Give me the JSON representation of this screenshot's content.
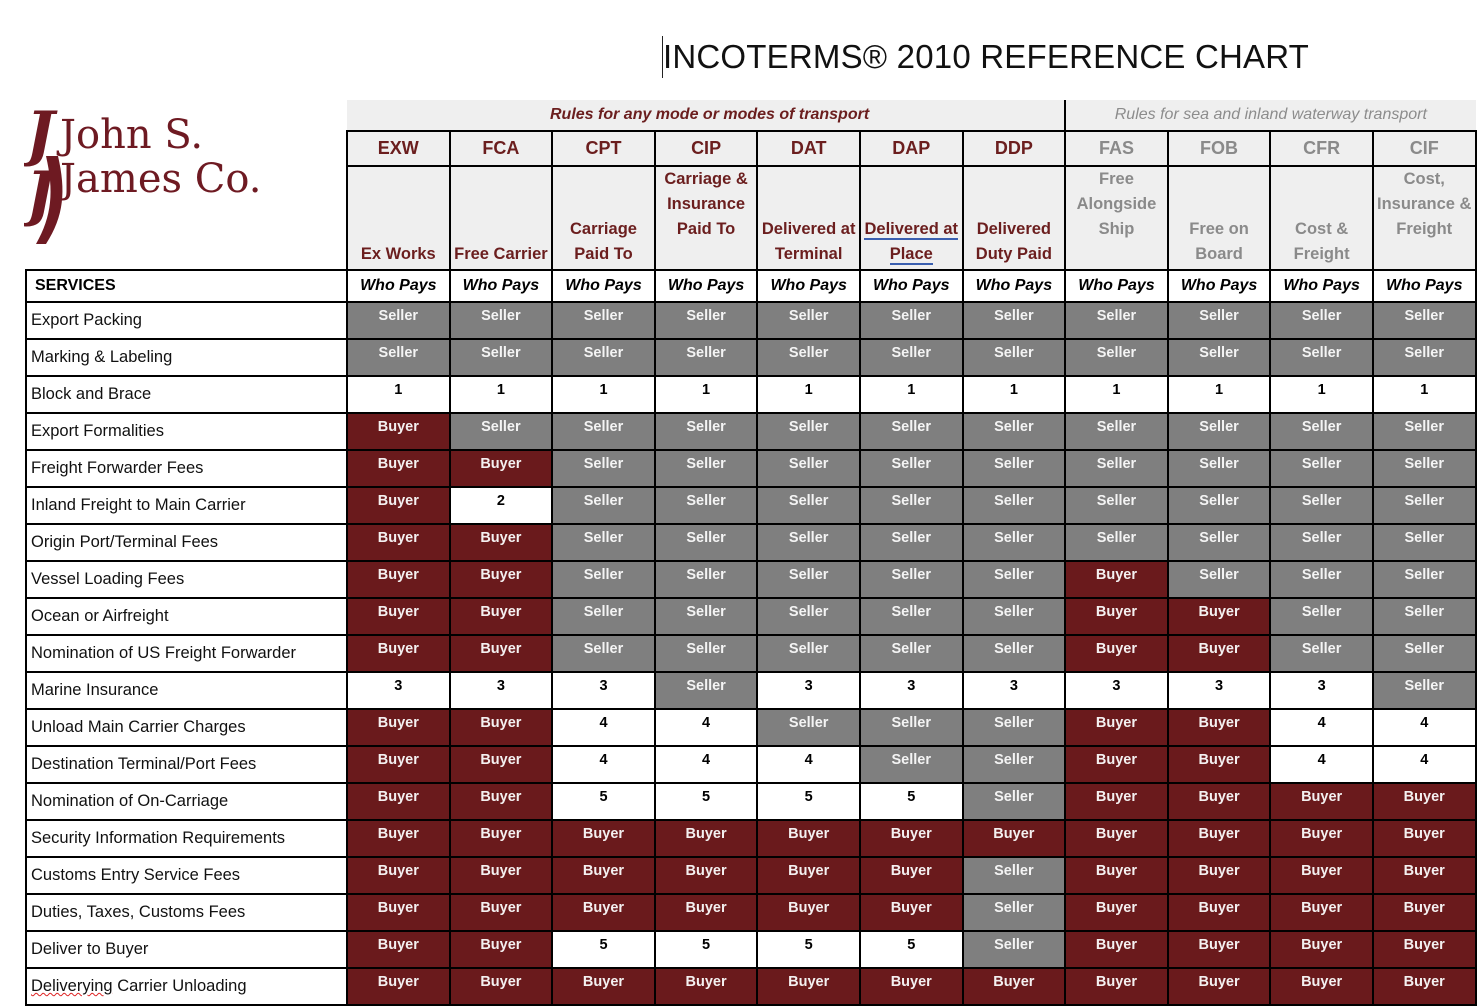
{
  "title": "INCOTERMS® 2010 REFERENCE CHART",
  "logo": {
    "line1": "John S.",
    "line2": "James Co."
  },
  "colors": {
    "buyer": "#6a1a1c",
    "seller": "#7f7f7f",
    "any_mode_text": "#6b1e1e",
    "sea_mode_text": "#8a8a8a",
    "header_bg": "#efefef"
  },
  "rule_groups": {
    "any_mode": "Rules for any mode or modes of transport",
    "sea_mode": "Rules for sea and inland waterway transport"
  },
  "terms": [
    {
      "code": "EXW",
      "name": "Ex Works",
      "group": "any"
    },
    {
      "code": "FCA",
      "name": "Free Carrier",
      "group": "any"
    },
    {
      "code": "CPT",
      "name": "Carriage Paid To",
      "group": "any"
    },
    {
      "code": "CIP",
      "name": "Carriage & Insurance Paid To",
      "group": "any"
    },
    {
      "code": "DAT",
      "name": "Delivered at Terminal",
      "group": "any"
    },
    {
      "code": "DAP",
      "name": "Delivered at Place",
      "group": "any"
    },
    {
      "code": "DDP",
      "name": "Delivered Duty Paid",
      "group": "any"
    },
    {
      "code": "FAS",
      "name": "Free Alongside Ship",
      "group": "sea"
    },
    {
      "code": "FOB",
      "name": "Free on Board",
      "group": "sea"
    },
    {
      "code": "CFR",
      "name": "Cost & Freight",
      "group": "sea"
    },
    {
      "code": "CIF",
      "name": "Cost, Insurance & Freight",
      "group": "sea"
    }
  ],
  "services_header": "SERVICES",
  "who_pays_label": "Who Pays",
  "rows": [
    {
      "service": "Export Packing",
      "values": [
        "Seller",
        "Seller",
        "Seller",
        "Seller",
        "Seller",
        "Seller",
        "Seller",
        "Seller",
        "Seller",
        "Seller",
        "Seller"
      ]
    },
    {
      "service": "Marking & Labeling",
      "values": [
        "Seller",
        "Seller",
        "Seller",
        "Seller",
        "Seller",
        "Seller",
        "Seller",
        "Seller",
        "Seller",
        "Seller",
        "Seller"
      ]
    },
    {
      "service": "Block and Brace",
      "values": [
        "1",
        "1",
        "1",
        "1",
        "1",
        "1",
        "1",
        "1",
        "1",
        "1",
        "1"
      ]
    },
    {
      "service": "Export Formalities",
      "values": [
        "Buyer",
        "Seller",
        "Seller",
        "Seller",
        "Seller",
        "Seller",
        "Seller",
        "Seller",
        "Seller",
        "Seller",
        "Seller"
      ]
    },
    {
      "service": "Freight Forwarder Fees",
      "values": [
        "Buyer",
        "Buyer",
        "Seller",
        "Seller",
        "Seller",
        "Seller",
        "Seller",
        "Seller",
        "Seller",
        "Seller",
        "Seller"
      ]
    },
    {
      "service": "Inland Freight to Main Carrier",
      "values": [
        "Buyer",
        "2",
        "Seller",
        "Seller",
        "Seller",
        "Seller",
        "Seller",
        "Seller",
        "Seller",
        "Seller",
        "Seller"
      ]
    },
    {
      "service": "Origin Port/Terminal Fees",
      "values": [
        "Buyer",
        "Buyer",
        "Seller",
        "Seller",
        "Seller",
        "Seller",
        "Seller",
        "Seller",
        "Seller",
        "Seller",
        "Seller"
      ]
    },
    {
      "service": "Vessel Loading Fees",
      "values": [
        "Buyer",
        "Buyer",
        "Seller",
        "Seller",
        "Seller",
        "Seller",
        "Seller",
        "Buyer",
        "Seller",
        "Seller",
        "Seller"
      ]
    },
    {
      "service": "Ocean or Airfreight",
      "values": [
        "Buyer",
        "Buyer",
        "Seller",
        "Seller",
        "Seller",
        "Seller",
        "Seller",
        "Buyer",
        "Buyer",
        "Seller",
        "Seller"
      ]
    },
    {
      "service": "Nomination of US Freight Forwarder",
      "values": [
        "Buyer",
        "Buyer",
        "Seller",
        "Seller",
        "Seller",
        "Seller",
        "Seller",
        "Buyer",
        "Buyer",
        "Seller",
        "Seller"
      ]
    },
    {
      "service": "Marine Insurance",
      "values": [
        "3",
        "3",
        "3",
        "Seller",
        "3",
        "3",
        "3",
        "3",
        "3",
        "3",
        "Seller"
      ]
    },
    {
      "service": "Unload Main Carrier Charges",
      "values": [
        "Buyer",
        "Buyer",
        "4",
        "4",
        "Seller",
        "Seller",
        "Seller",
        "Buyer",
        "Buyer",
        "4",
        "4"
      ]
    },
    {
      "service": "Destination Terminal/Port Fees",
      "values": [
        "Buyer",
        "Buyer",
        "4",
        "4",
        "4",
        "Seller",
        "Seller",
        "Buyer",
        "Buyer",
        "4",
        "4"
      ]
    },
    {
      "service": "Nomination of On-Carriage",
      "values": [
        "Buyer",
        "Buyer",
        "5",
        "5",
        "5",
        "5",
        "Seller",
        "Buyer",
        "Buyer",
        "Buyer",
        "Buyer"
      ]
    },
    {
      "service": "Security Information Requirements",
      "values": [
        "Buyer",
        "Buyer",
        "Buyer",
        "Buyer",
        "Buyer",
        "Buyer",
        "Buyer",
        "Buyer",
        "Buyer",
        "Buyer",
        "Buyer"
      ]
    },
    {
      "service": "Customs Entry Service Fees",
      "values": [
        "Buyer",
        "Buyer",
        "Buyer",
        "Buyer",
        "Buyer",
        "Buyer",
        "Seller",
        "Buyer",
        "Buyer",
        "Buyer",
        "Buyer"
      ]
    },
    {
      "service": "Duties, Taxes, Customs Fees",
      "values": [
        "Buyer",
        "Buyer",
        "Buyer",
        "Buyer",
        "Buyer",
        "Buyer",
        "Seller",
        "Buyer",
        "Buyer",
        "Buyer",
        "Buyer"
      ]
    },
    {
      "service": "Deliver to Buyer",
      "values": [
        "Buyer",
        "Buyer",
        "5",
        "5",
        "5",
        "5",
        "Seller",
        "Buyer",
        "Buyer",
        "Buyer",
        "Buyer"
      ]
    },
    {
      "service": "Deliverying Carrier Unloading",
      "values": [
        "Buyer",
        "Buyer",
        "Buyer",
        "Buyer",
        "Buyer",
        "Buyer",
        "Buyer",
        "Buyer",
        "Buyer",
        "Buyer",
        "Buyer"
      ]
    }
  ]
}
